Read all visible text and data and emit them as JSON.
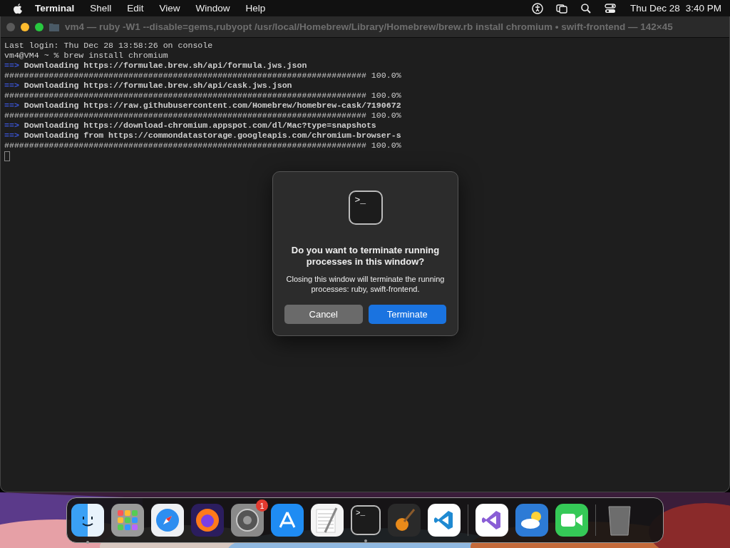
{
  "menu_bar": {
    "app": "Terminal",
    "items": [
      "Shell",
      "Edit",
      "View",
      "Window",
      "Help"
    ],
    "date": "Thu Dec 28",
    "time": "3:40 PM"
  },
  "window": {
    "title": "vm4 — ruby -W1 --disable=gems,rubyopt /usr/local/Homebrew/Library/Homebrew/brew.rb install chromium • swift-frontend — 142×45",
    "close_disabled": true
  },
  "terminal": {
    "lines": [
      {
        "kind": "plain",
        "text": "Last login: Thu Dec 28 13:58:26 on console"
      },
      {
        "kind": "plain",
        "text": "vm4@VM4 ~ % brew install chromium"
      },
      {
        "kind": "step",
        "marker": "==>",
        "text": "Downloading https://formulae.brew.sh/api/formula.jws.json"
      },
      {
        "kind": "plain",
        "text": "######################################################################### 100.0%"
      },
      {
        "kind": "step",
        "marker": "==>",
        "text": "Downloading https://formulae.brew.sh/api/cask.jws.json"
      },
      {
        "kind": "plain",
        "text": "######################################################################### 100.0%"
      },
      {
        "kind": "step",
        "marker": "==>",
        "text": "Downloading https://raw.githubusercontent.com/Homebrew/homebrew-cask/7190672"
      },
      {
        "kind": "plain",
        "text": "######################################################################### 100.0%"
      },
      {
        "kind": "step",
        "marker": "==>",
        "text": "Downloading https://download-chromium.appspot.com/dl/Mac?type=snapshots"
      },
      {
        "kind": "step",
        "marker": "==>",
        "text": "Downloading from https://commondatastorage.googleapis.com/chromium-browser-s"
      },
      {
        "kind": "plain",
        "text": "######################################################################### 100.0%"
      },
      {
        "kind": "cursor"
      }
    ]
  },
  "dialog": {
    "icon_glyph": ">_",
    "title": "Do you want to terminate running processes in this window?",
    "message": "Closing this window will terminate the running processes: ruby, swift-frontend.",
    "buttons": [
      {
        "label": "Cancel",
        "kind": "secondary"
      },
      {
        "label": "Terminate",
        "kind": "primary"
      }
    ]
  },
  "dock": {
    "items": [
      {
        "kind": "finder",
        "running": true
      },
      {
        "kind": "launchpad",
        "running": false
      },
      {
        "kind": "safari",
        "running": false
      },
      {
        "kind": "firefox",
        "running": false
      },
      {
        "kind": "settings",
        "running": false,
        "badge": "1"
      },
      {
        "kind": "appstore",
        "running": false
      },
      {
        "kind": "textedit",
        "running": false
      },
      {
        "kind": "terminal",
        "running": true,
        "glyph": ">_"
      },
      {
        "kind": "garageband",
        "running": false
      },
      {
        "kind": "vscode",
        "running": false
      },
      {
        "kind": "separator"
      },
      {
        "kind": "visualstudio",
        "running": false
      },
      {
        "kind": "weather",
        "running": false
      },
      {
        "kind": "facetime",
        "running": false
      },
      {
        "kind": "separator"
      },
      {
        "kind": "trash",
        "running": false
      }
    ]
  }
}
